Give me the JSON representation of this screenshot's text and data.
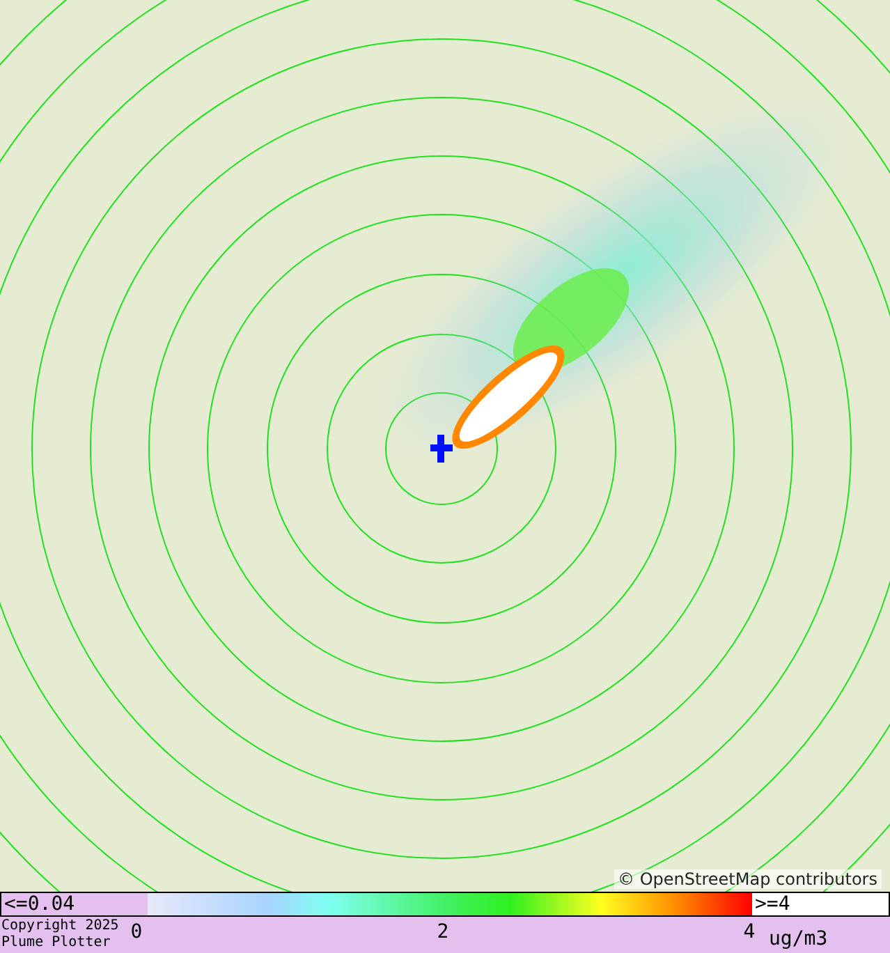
{
  "map": {
    "attribution": "© OpenStreetMap contributors"
  },
  "legend": {
    "low_label": "<=0.04",
    "high_label": ">=4",
    "ticks": [
      "0",
      "2",
      "4"
    ],
    "unit": "ug/m3"
  },
  "footer": {
    "copyright_lines": [
      "Copyright 2025",
      "Plume Plotter"
    ]
  }
}
